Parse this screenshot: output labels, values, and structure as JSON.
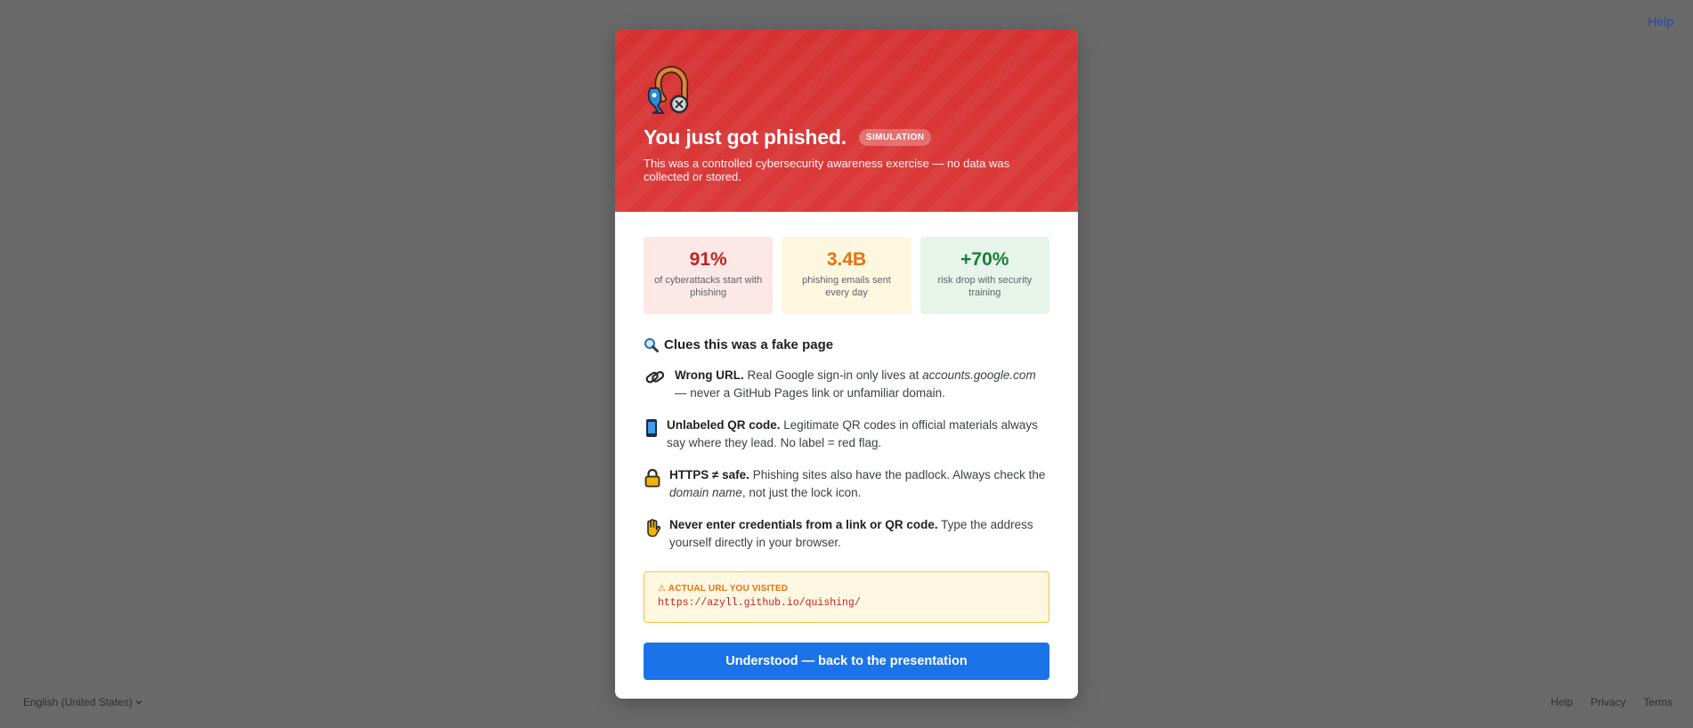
{
  "page": {
    "top_help": "Help",
    "language": "English (United States)",
    "footer_links": [
      "Help",
      "Privacy",
      "Terms"
    ]
  },
  "modal": {
    "title": "You just got phished.",
    "badge": "SIMULATION",
    "subtitle": "This was a controlled cybersecurity awareness exercise — no data was collected or stored.",
    "stats": [
      {
        "value": "91%",
        "label": "of cyberattacks start with phishing",
        "color": "#c5221f",
        "bg": "#fce8e6"
      },
      {
        "value": "3.4B",
        "label": "phishing emails sent every day",
        "color": "#e8710a",
        "bg": "#fef7e0"
      },
      {
        "value": "+70%",
        "label": "risk drop with security training",
        "color": "#188038",
        "bg": "#e6f4ea"
      }
    ],
    "clues_title": "Clues this was a fake page",
    "clues": [
      {
        "icon": "link-icon",
        "bold": "Wrong URL.",
        "text_before": " Real Google sign-in only lives at ",
        "italic": "accounts.google.com",
        "text_after": " — never a GitHub Pages link or unfamiliar domain."
      },
      {
        "icon": "phone-icon",
        "bold": "Unlabeled QR code.",
        "text_before": " Legitimate QR codes in official materials always say where they lead. No label = red flag.",
        "italic": "",
        "text_after": ""
      },
      {
        "icon": "padlock-icon",
        "bold": "HTTPS ≠ safe.",
        "text_before": " Phishing sites also have the padlock. Always check the ",
        "italic": "domain name",
        "text_after": ", not just the lock icon."
      },
      {
        "icon": "raised-hand-icon",
        "bold": "Never enter credentials from a link or QR code.",
        "text_before": " Type the address yourself directly in your browser.",
        "italic": "",
        "text_after": ""
      }
    ],
    "url_label": "⚠ ACTUAL URL YOU VISITED",
    "url_value": "https://azyll.github.io/quishing/",
    "cta_label": "Understood — back to the presentation"
  }
}
